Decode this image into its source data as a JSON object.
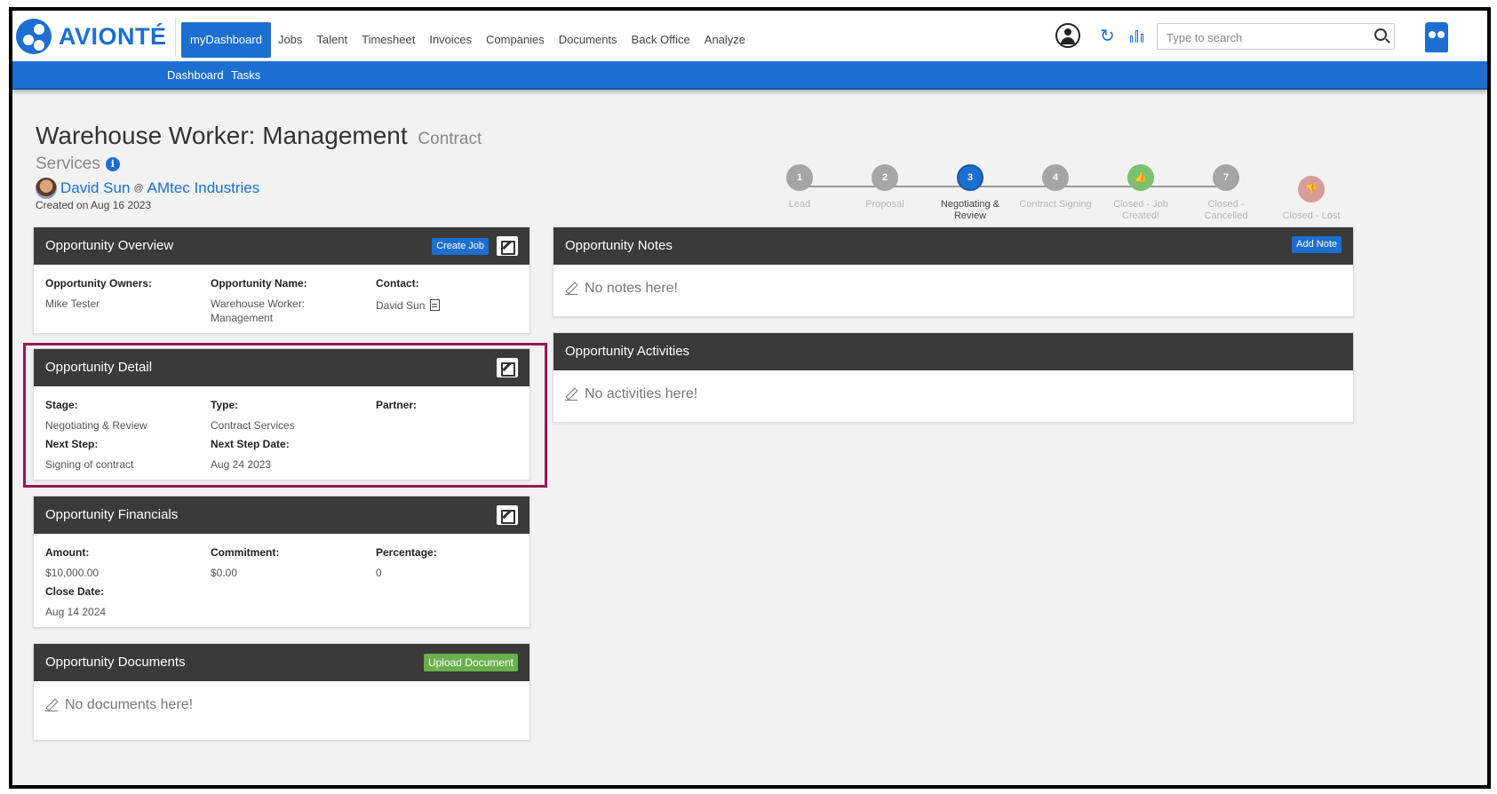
{
  "app": {
    "brand": "AVIONTÉ",
    "brand_color": "#1c6fd1"
  },
  "nav": {
    "items": [
      "myDashboard",
      "Jobs",
      "Talent",
      "Timesheet",
      "Invoices",
      "Companies",
      "Documents",
      "Back Office",
      "Analyze"
    ],
    "active": "myDashboard"
  },
  "search": {
    "placeholder": "Type to search"
  },
  "subnav": {
    "items": [
      "Dashboard",
      "Tasks"
    ]
  },
  "header": {
    "title": "Warehouse Worker: Management",
    "type_part1": "Contract",
    "type_part2": "Services",
    "contact_name": "David Sun",
    "at": "@",
    "company": "AMtec Industries",
    "created": "Created on Aug 16 2023"
  },
  "stepper": {
    "steps": [
      {
        "badge": "1",
        "label": "Lead",
        "state": "done"
      },
      {
        "badge": "2",
        "label": "Proposal",
        "state": "done"
      },
      {
        "badge": "3",
        "label": "Negotiating & Review",
        "state": "active"
      },
      {
        "badge": "4",
        "label": "Contract Signing",
        "state": "todo"
      },
      {
        "badge": "thumbs-up-icon",
        "label": "Closed - Job Created!",
        "state": "won"
      },
      {
        "badge": "7",
        "label": "Closed - Cancelled",
        "state": "todo"
      },
      {
        "badge": "thumbs-down-icon",
        "label": "Closed - Lost",
        "state": "lost"
      }
    ]
  },
  "overview": {
    "title": "Opportunity Overview",
    "create_job": "Create Job",
    "owners_label": "Opportunity Owners:",
    "owners_value": "Mike Tester",
    "name_label": "Opportunity Name:",
    "name_value": "Warehouse Worker: Management",
    "contact_label": "Contact:",
    "contact_value": "David Sun"
  },
  "detail": {
    "title": "Opportunity Detail",
    "stage_label": "Stage:",
    "stage_value": "Negotiating & Review",
    "type_label": "Type:",
    "type_value": "Contract Services",
    "partner_label": "Partner:",
    "next_step_label": "Next Step:",
    "next_step_value": "Signing of contract",
    "next_step_date_label": "Next Step Date:",
    "next_step_date_value": "Aug 24 2023"
  },
  "financials": {
    "title": "Opportunity Financials",
    "amount_label": "Amount:",
    "amount_value": "$10,000.00",
    "commitment_label": "Commitment:",
    "commitment_value": "$0.00",
    "percentage_label": "Percentage:",
    "percentage_value": "0",
    "close_date_label": "Close Date:",
    "close_date_value": "Aug 14 2024"
  },
  "documents": {
    "title": "Opportunity Documents",
    "upload": "Upload Document",
    "empty": "No documents here!"
  },
  "notes": {
    "title": "Opportunity Notes",
    "add": "Add Note",
    "empty": "No notes here!"
  },
  "activities": {
    "title": "Opportunity Activities",
    "empty": "No activities here!"
  },
  "colors": {
    "header_dark": "#3a3a3a",
    "accent_blue": "#1c6fd1",
    "success_green": "#6ab04c",
    "highlight": "#a0144f"
  }
}
